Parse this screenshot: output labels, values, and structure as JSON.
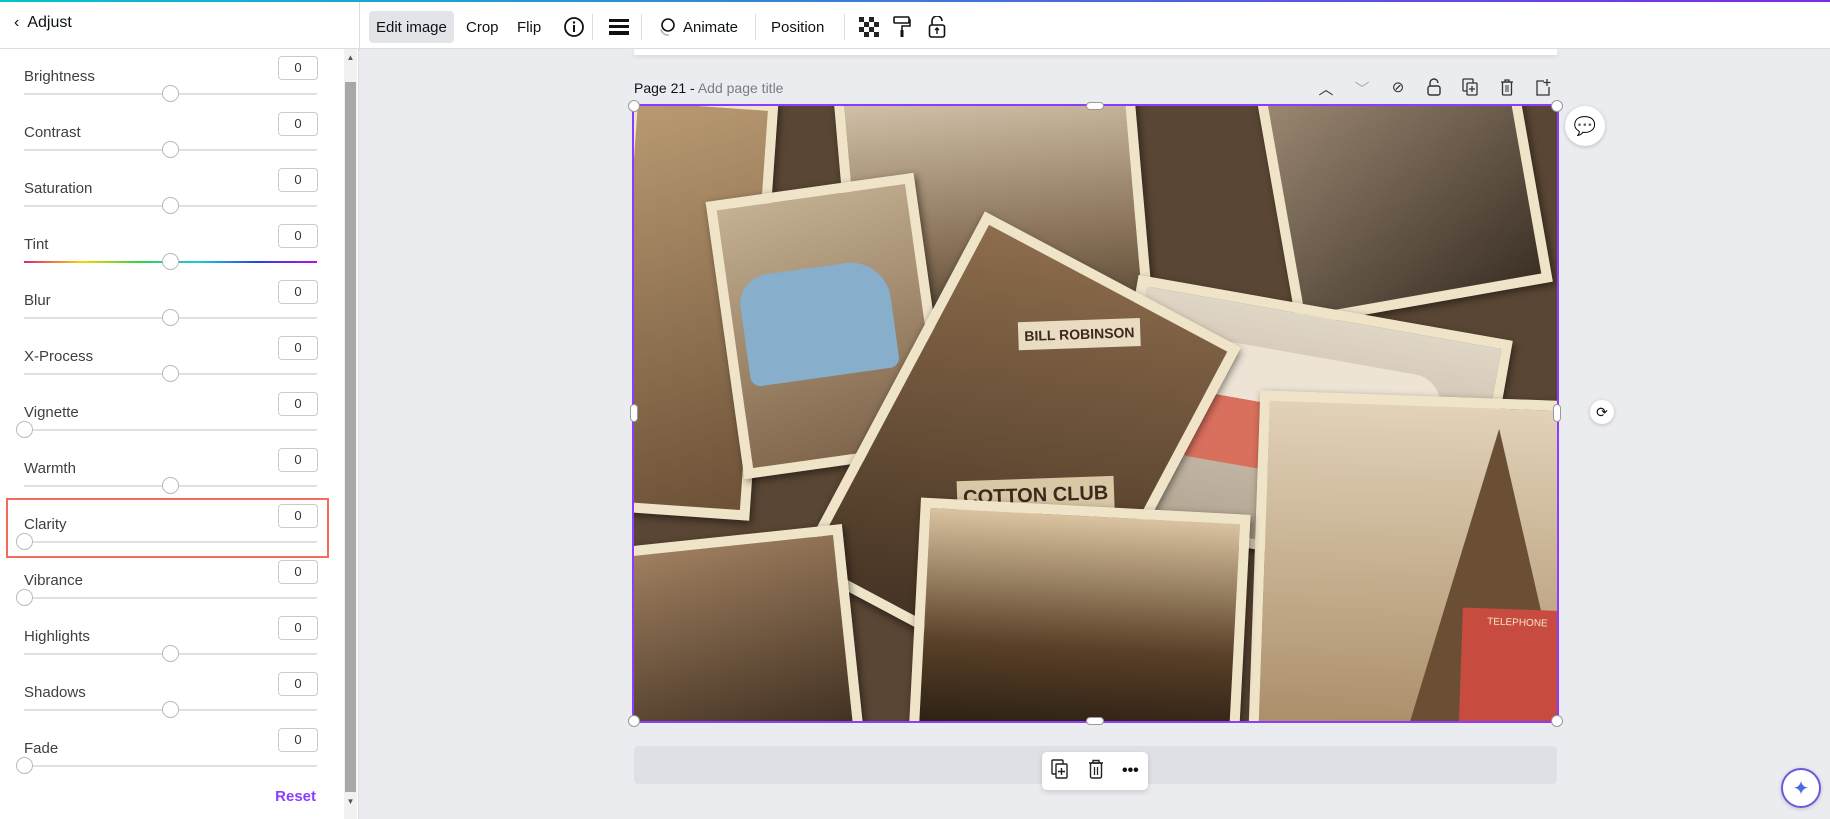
{
  "header": {
    "back_label": "Adjust"
  },
  "toolbar": {
    "edit_image": "Edit image",
    "crop": "Crop",
    "flip": "Flip",
    "animate": "Animate",
    "position": "Position"
  },
  "adjust": {
    "items": [
      {
        "label": "Brightness",
        "value": "0",
        "level": 0.5
      },
      {
        "label": "Contrast",
        "value": "0",
        "level": 0.5
      },
      {
        "label": "Saturation",
        "value": "0",
        "level": 0.5
      },
      {
        "label": "Tint",
        "value": "0",
        "level": 0.5
      },
      {
        "label": "Blur",
        "value": "0",
        "level": 0.5
      },
      {
        "label": "X-Process",
        "value": "0",
        "level": 0.5
      },
      {
        "label": "Vignette",
        "value": "0",
        "level": 0
      },
      {
        "label": "Warmth",
        "value": "0",
        "level": 0.5
      },
      {
        "label": "Clarity",
        "value": "0",
        "level": 0
      },
      {
        "label": "Vibrance",
        "value": "0",
        "level": 0
      },
      {
        "label": "Highlights",
        "value": "0",
        "level": 0.5
      },
      {
        "label": "Shadows",
        "value": "0",
        "level": 0.5
      },
      {
        "label": "Fade",
        "value": "0",
        "level": 0
      }
    ],
    "reset": "Reset"
  },
  "page": {
    "number": "Page 21 -",
    "title_placeholder": "Add page title"
  },
  "image_text": {
    "sign1": "BILL ROBINSON",
    "sign2": "COTTON CLUB",
    "phone": "TELEPHONE"
  },
  "colors": {
    "accent": "#8b3dff",
    "highlight": "#f26b5b"
  }
}
